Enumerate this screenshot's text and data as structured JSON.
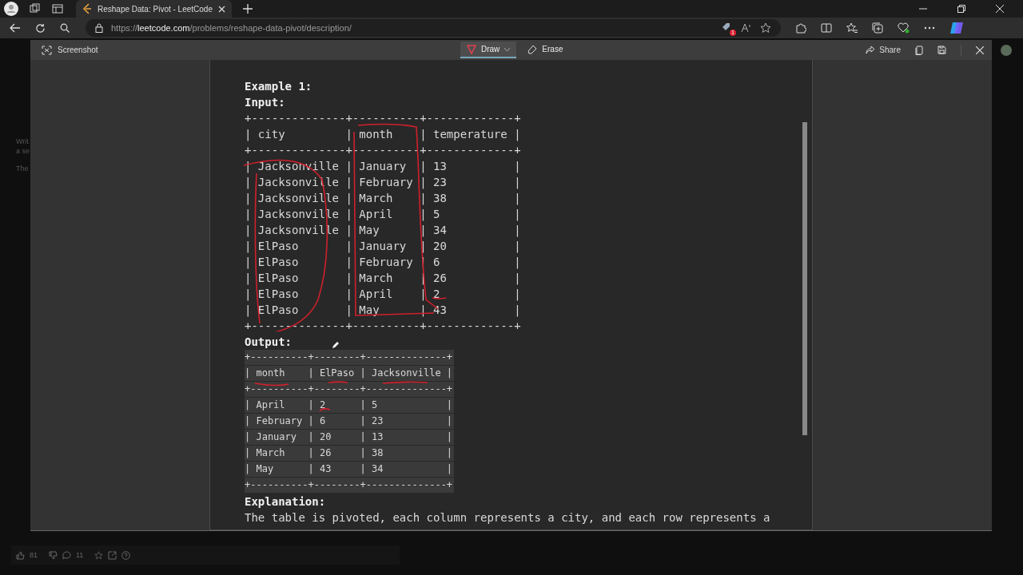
{
  "browser": {
    "tab_title": "Reshape Data: Pivot - LeetCode",
    "url_scheme": "https://",
    "url_host": "leetcode.com",
    "url_path": "/problems/reshape-data-pivot/description/",
    "badge": "1"
  },
  "page_behind": {
    "fragments": [
      "Writ",
      "a se",
      "The"
    ],
    "likes": "81",
    "comments": "11"
  },
  "screenshot_tool": {
    "title": "Screenshot",
    "tools": [
      {
        "label": "Draw",
        "kind": "draw",
        "selected": true
      },
      {
        "label": "Erase",
        "kind": "erase",
        "selected": false
      }
    ],
    "share": "Share"
  },
  "example": {
    "heading": "Example 1:",
    "input_label": "Input:",
    "input_lines": [
      "+--------------+----------+-------------+",
      "| city         | month    | temperature |",
      "+--------------+----------+-------------+",
      "| Jacksonville | January  | 13          |",
      "| Jacksonville | February | 23          |",
      "| Jacksonville | March    | 38          |",
      "| Jacksonville | April    | 5           |",
      "| Jacksonville | May      | 34          |",
      "| ElPaso       | January  | 20          |",
      "| ElPaso       | February | 6           |",
      "| ElPaso       | March    | 26          |",
      "| ElPaso       | April    | 2           |",
      "| ElPaso       | May      | 43          |",
      "+--------------+----------+-------------+"
    ],
    "output_label": "Output:",
    "output_lines": [
      "+----------+--------+--------------+",
      "| month    | ElPaso | Jacksonville |",
      "+----------+--------+--------------+",
      "| April    | 2      | 5            |",
      "| February | 6      | 23           |",
      "| January  | 20     | 13           |",
      "| March    | 26     | 38           |",
      "| May      | 43     | 34           |",
      "+----------+--------+--------------+"
    ],
    "explanation_label": "Explanation:",
    "explanation": "The table is pivoted, each column represents a city, and each row represents a"
  }
}
